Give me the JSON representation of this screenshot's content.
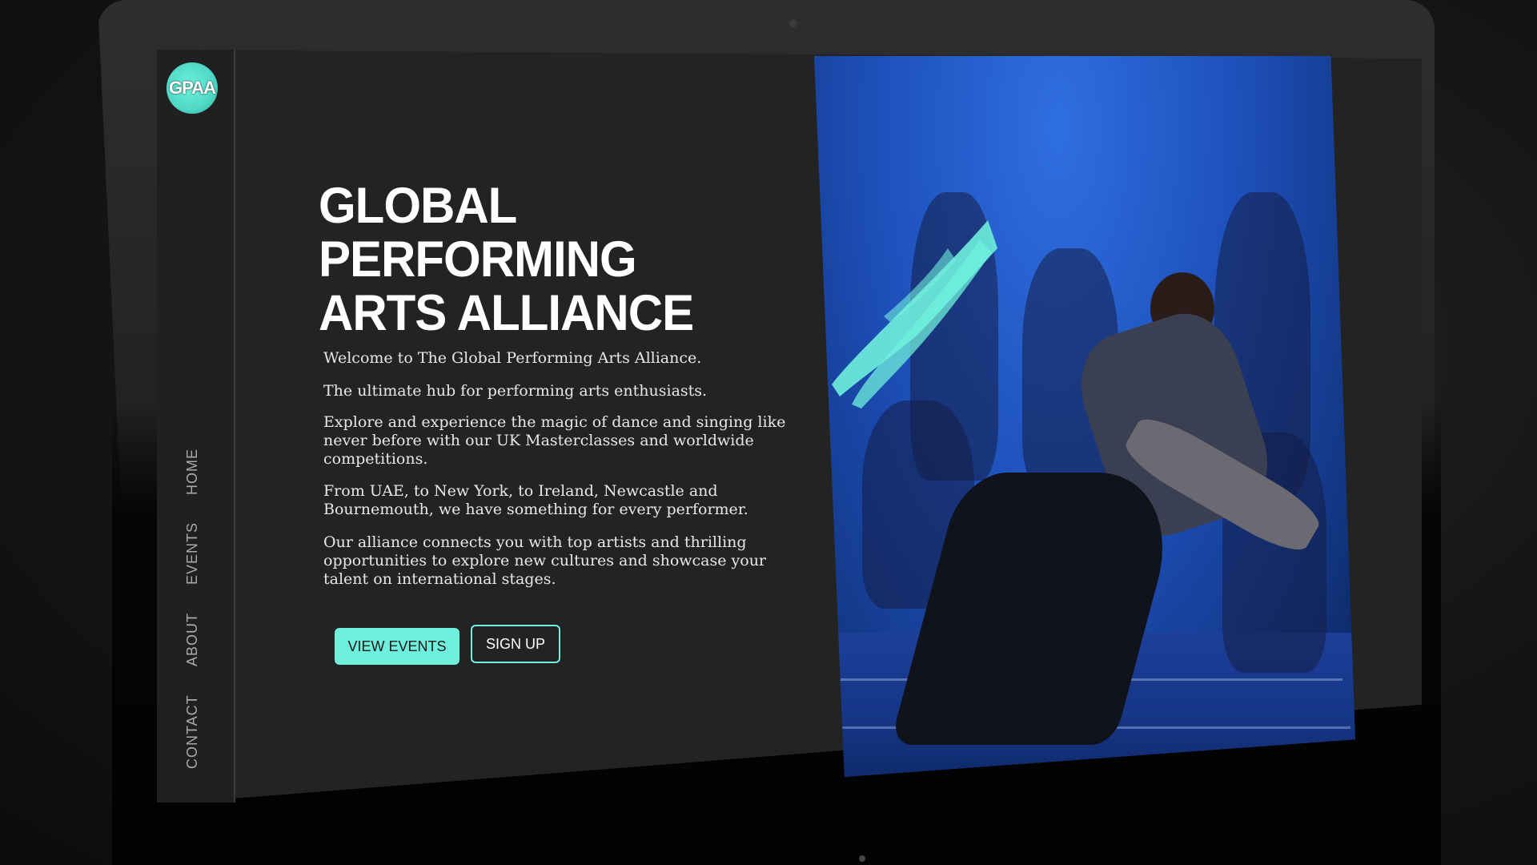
{
  "brand": {
    "logo_text": "GPAA",
    "accent_color": "#6ff0dc"
  },
  "nav": {
    "items": [
      {
        "label": "HOME"
      },
      {
        "label": "EVENTS"
      },
      {
        "label": "ABOUT"
      },
      {
        "label": "CONTACT"
      }
    ]
  },
  "hero": {
    "title_lines": [
      "GLOBAL",
      "PERFORMING",
      "ARTS ALLIANCE"
    ],
    "paragraphs": [
      "Welcome to The Global Performing Arts Alliance.",
      "The ultimate hub for performing arts enthusiasts.",
      "Explore and experience the magic of dance and singing like never before with our UK Masterclasses and worldwide competitions.",
      "From UAE, to New York, to Ireland, Newcastle and Bournemouth, we have something for every performer.",
      "Our alliance connects you with top artists and thrilling opportunities to explore new cultures and showcase your talent on international stages."
    ],
    "buttons": {
      "view_events": "VIEW EVENTS",
      "sign_up": "SIGN UP"
    }
  }
}
